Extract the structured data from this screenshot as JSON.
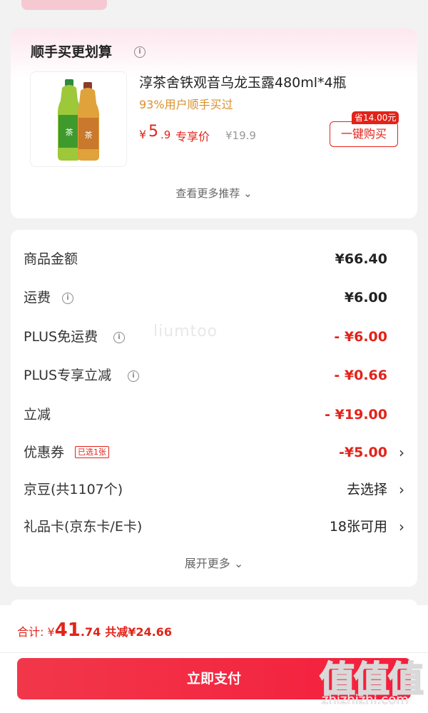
{
  "recommend": {
    "title": "顺手买更划算",
    "product_name": "淳茶舍铁观音乌龙玉露480ml*4瓶",
    "buyers_text": "93%用户顺手买过",
    "price_currency": "¥",
    "price_int": "5",
    "price_dec": ".9",
    "price_tag": "专享价",
    "original_price": "¥19.9",
    "save_badge": "省14.00元",
    "buy_button": "一键购买",
    "more_link": "查看更多推荐 ⌄"
  },
  "summary": {
    "rows": [
      {
        "label": "商品金额",
        "value": "¥66.40"
      },
      {
        "label": "运费",
        "value": "¥6.00"
      },
      {
        "label": "PLUS免运费",
        "value": "- ¥6.00"
      },
      {
        "label": "PLUS专享立减",
        "value": "- ¥0.66"
      },
      {
        "label": "立减",
        "value": "- ¥19.00"
      },
      {
        "label": "优惠券",
        "tag": "已选1张",
        "value": "-¥5.00"
      },
      {
        "label": "京豆(共1107个)",
        "value": "去选择"
      },
      {
        "label": "礼品卡(京东卡/E卡)",
        "value": "18张可用"
      }
    ],
    "expand_link": "展开更多 ⌄"
  },
  "footer": {
    "total_label": "合计: ",
    "total_currency": "¥",
    "total_int": "41",
    "total_dec": ".74",
    "saved_text": "共减¥24.66",
    "pay_button": "立即支付"
  },
  "watermark": {
    "center_text": "liumtoo",
    "logo_text": "值值值",
    "site_text": "zhizhizhi.com"
  },
  "icons": {
    "info": "info-icon",
    "chevron": "chevron-right-icon"
  },
  "colors": {
    "accent_red": "#e2231a",
    "orange": "#d9922e",
    "pay_button": "#f41e3c"
  }
}
